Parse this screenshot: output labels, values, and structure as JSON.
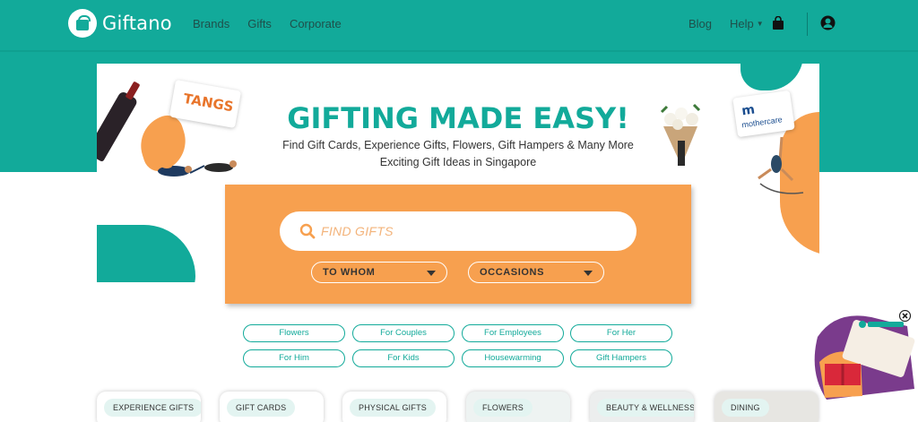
{
  "header": {
    "brand": "Giftano",
    "nav_left": [
      "Brands",
      "Gifts",
      "Corporate"
    ],
    "blog": "Blog",
    "help": "Help"
  },
  "hero": {
    "title": "GIFTING MADE EASY!",
    "subtitle_line1": "Find Gift Cards, Experience Gifts, Flowers, Gift Hampers & Many More",
    "subtitle_line2": "Exciting Gift Ideas in Singapore",
    "card_tangs": "TANGS",
    "card_mothercare_logo": "m",
    "card_mothercare_name": "mothercare"
  },
  "search": {
    "placeholder": "FIND GIFTS",
    "dropdown_whom": "TO WHOM",
    "dropdown_occasions": "OCCASIONS"
  },
  "chips": [
    "Flowers",
    "For Couples",
    "For Employees",
    "For Her",
    "For Him",
    "For Kids",
    "Housewarming",
    "Gift Hampers"
  ],
  "categories": [
    "EXPERIENCE GIFTS",
    "GIFT CARDS",
    "PHYSICAL GIFTS",
    "FLOWERS",
    "BEAUTY & WELLNESS",
    "DINING"
  ],
  "colors": {
    "brand_teal": "#12aa9a",
    "accent_orange": "#f7a04f"
  },
  "icons": [
    "gift-logo-icon",
    "bag-icon",
    "user-icon",
    "search-icon",
    "chevron-down-icon",
    "close-icon"
  ]
}
